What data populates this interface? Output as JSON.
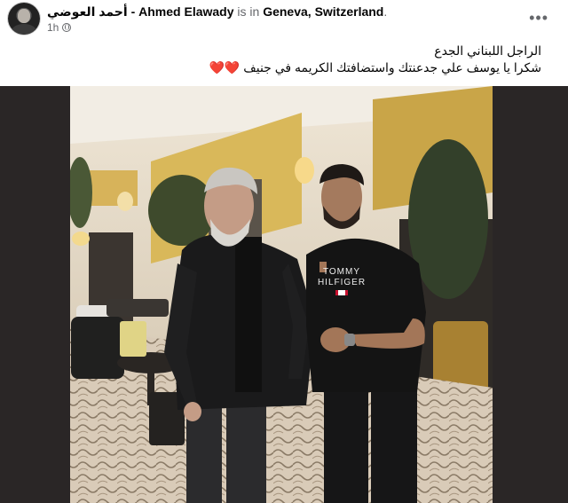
{
  "post": {
    "author_arabic": "أحمد العوضي",
    "author_separator": " - ",
    "author_latin": "Ahmed Elawady",
    "status_verb": " is in ",
    "location": "Geneva, Switzerland",
    "period": ".",
    "time": "1h",
    "audience_icon": "globe-icon",
    "more_icon": "ellipsis-icon",
    "caption_line1": "الراجل اللبناني الجدع",
    "caption_line2": "شكرا يا يوسف علي جدعنتك واستضافتك الكريمه في جنيف",
    "caption_emoji": "❤️❤️",
    "shirt_text_line1": "TOMMY",
    "shirt_text_line2": "HILFIGER"
  },
  "colors": {
    "text_primary": "#050505",
    "text_secondary": "#65676b",
    "heart": "#e41e3f",
    "photo_frame": "#2a2626"
  }
}
